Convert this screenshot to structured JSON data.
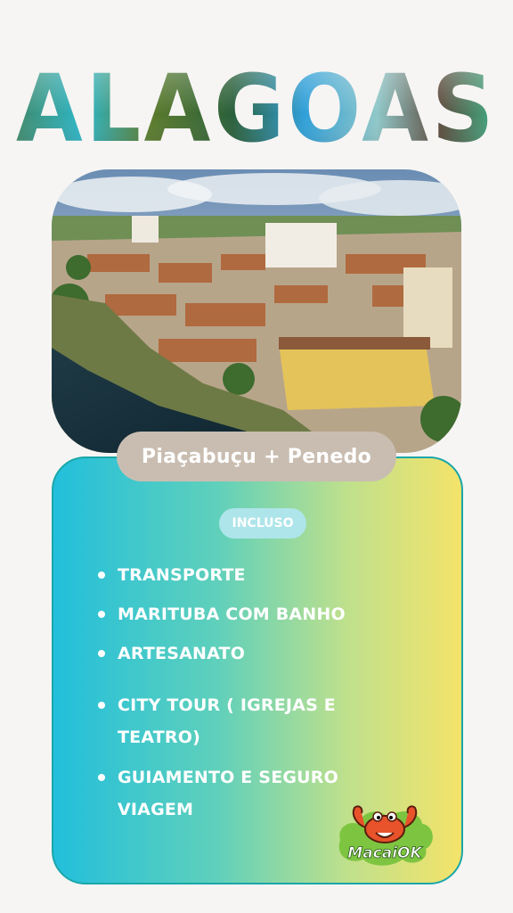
{
  "header": {
    "title": "ALAGOAS"
  },
  "hero": {
    "location_label": "Piaçabuçu + Penedo"
  },
  "included": {
    "badge": "INCLUSO",
    "items": [
      {
        "label": "TRANSPORTE"
      },
      {
        "label": "MARITUBA COM BANHO"
      },
      {
        "label": "ARTESANATO"
      },
      {
        "label": "CITY TOUR ( IGREJAS E TEATRO)"
      },
      {
        "label": "GUIAMENTO E SEGURO VIAGEM"
      }
    ]
  },
  "brand": {
    "logo_text": "MacaiOK",
    "logo_icon": "crab-icon"
  },
  "colors": {
    "background": "#f6f5f3",
    "pill": "#c9bdb1",
    "card_left": "#22bfdc",
    "card_right": "#f4e36a",
    "badge": "#aee5ea"
  }
}
